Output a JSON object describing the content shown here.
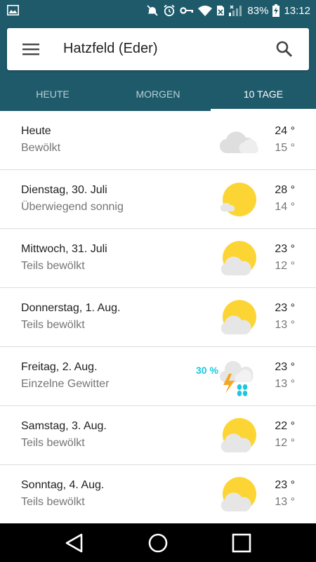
{
  "status": {
    "battery_percent": "83%",
    "time": "13:12"
  },
  "header": {
    "location": "Hatzfeld (Eder)",
    "tabs": [
      {
        "label": "HEUTE",
        "active": false
      },
      {
        "label": "MORGEN",
        "active": false
      },
      {
        "label": "10 TAGE",
        "active": true
      }
    ]
  },
  "forecast": [
    {
      "day": "Heute",
      "condition": "Bewölkt",
      "high": "24 °",
      "low": "15 °",
      "icon": "cloudy-icon"
    },
    {
      "day": "Dienstag, 30. Juli",
      "condition": "Überwiegend sonnig",
      "high": "28 °",
      "low": "14 °",
      "icon": "mostly-sunny-icon"
    },
    {
      "day": "Mittwoch, 31. Juli",
      "condition": "Teils bewölkt",
      "high": "23 °",
      "low": "12 °",
      "icon": "partly-cloudy-icon"
    },
    {
      "day": "Donnerstag, 1. Aug.",
      "condition": "Teils bewölkt",
      "high": "23 °",
      "low": "13 °",
      "icon": "partly-cloudy-icon"
    },
    {
      "day": "Freitag, 2. Aug.",
      "condition": "Einzelne Gewitter",
      "high": "23 °",
      "low": "13 °",
      "icon": "thunderstorm-icon",
      "precip": "30 %"
    },
    {
      "day": "Samstag, 3. Aug.",
      "condition": "Teils bewölkt",
      "high": "22 °",
      "low": "12 °",
      "icon": "partly-cloudy-icon"
    },
    {
      "day": "Sonntag, 4. Aug.",
      "condition": "Teils bewölkt",
      "high": "23 °",
      "low": "13 °",
      "icon": "partly-cloudy-icon"
    }
  ],
  "colors": {
    "header_bg": "#1f5a6b",
    "sun": "#fcd535",
    "cloud": "#e6e6e6",
    "precip": "#18c8e0"
  }
}
